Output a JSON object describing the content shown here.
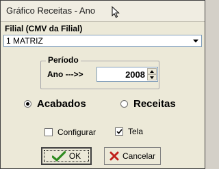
{
  "window": {
    "title": "Gráfico Receitas - Ano"
  },
  "filial": {
    "label": "Filial (CMV da Filial)",
    "selected": "1 MATRIZ"
  },
  "periodo": {
    "legend": "Período",
    "ano_label": "Ano --->>",
    "ano_value": "2008"
  },
  "tipo": {
    "options": [
      {
        "label": "Acabados",
        "selected": true
      },
      {
        "label": "Receitas",
        "selected": false
      }
    ]
  },
  "opcoes": {
    "configurar": {
      "label": "Configurar",
      "checked": false
    },
    "tela": {
      "label": "Tela",
      "checked": true
    }
  },
  "buttons": {
    "ok_label": "OK",
    "cancel_label": "Cancelar"
  },
  "colors": {
    "ok_check": "#2e8b1f",
    "cancel_x": "#c0201a"
  }
}
